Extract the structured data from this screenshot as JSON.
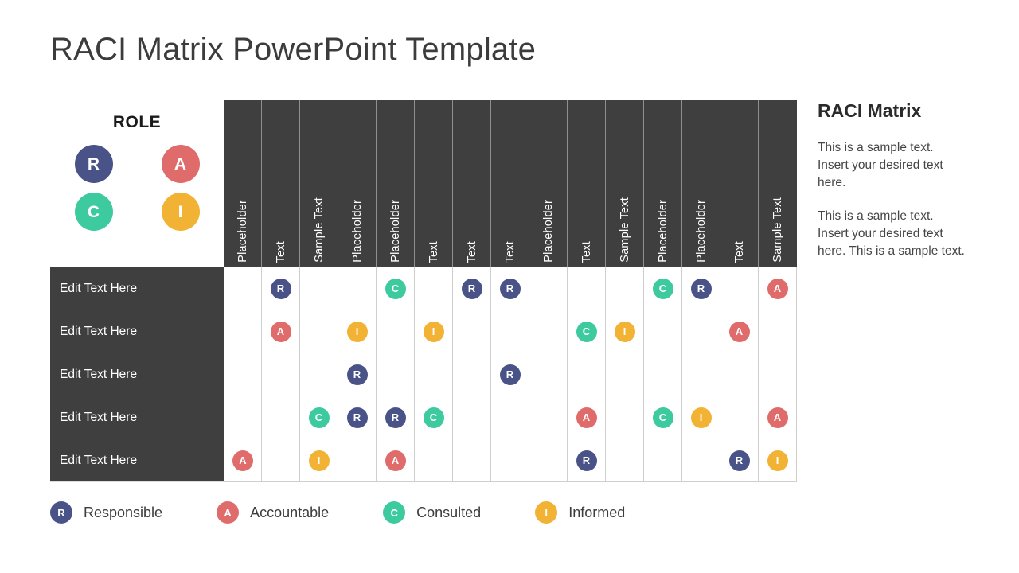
{
  "slide": {
    "title": "RACI Matrix PowerPoint Template"
  },
  "role_legend": {
    "heading": "ROLE",
    "items": [
      {
        "key": "R",
        "color": "#4A5387"
      },
      {
        "key": "A",
        "color": "#E06B6B"
      },
      {
        "key": "C",
        "color": "#3DCA9E"
      },
      {
        "key": "I",
        "color": "#F2B233"
      }
    ]
  },
  "matrix": {
    "column_headers": [
      "Placeholder",
      "Text",
      "Sample Text",
      "Placeholder",
      "Placeholder",
      "Text",
      "Text",
      "Text",
      "Placeholder",
      "Text",
      "Sample Text",
      "Placeholder",
      "Placeholder",
      "Text",
      "Sample Text"
    ],
    "rows": [
      {
        "label": "Edit Text Here",
        "cells": [
          "",
          "R",
          "",
          "",
          "C",
          "",
          "R",
          "R",
          "",
          "",
          "",
          "C",
          "R",
          "",
          "A"
        ]
      },
      {
        "label": "Edit Text Here",
        "cells": [
          "",
          "A",
          "",
          "I",
          "",
          "I",
          "",
          "",
          "",
          "C",
          "I",
          "",
          "",
          "A",
          ""
        ]
      },
      {
        "label": "Edit Text Here",
        "cells": [
          "",
          "",
          "",
          "R",
          "",
          "",
          "",
          "R",
          "",
          "",
          "",
          "",
          "",
          "",
          ""
        ]
      },
      {
        "label": "Edit Text Here",
        "cells": [
          "",
          "",
          "C",
          "R",
          "R",
          "C",
          "",
          "",
          "",
          "A",
          "",
          "C",
          "I",
          "",
          "A"
        ]
      },
      {
        "label": "Edit Text Here",
        "cells": [
          "A",
          "",
          "I",
          "",
          "A",
          "",
          "",
          "",
          "",
          "R",
          "",
          "",
          "",
          "R",
          "I"
        ]
      }
    ]
  },
  "legend": {
    "items": [
      {
        "key": "R",
        "label": "Responsible",
        "color": "#4A5387"
      },
      {
        "key": "A",
        "label": "Accountable",
        "color": "#E06B6B"
      },
      {
        "key": "C",
        "label": "Consulted",
        "color": "#3DCA9E"
      },
      {
        "key": "I",
        "label": "Informed",
        "color": "#F2B233"
      }
    ]
  },
  "side_panel": {
    "title": "RACI Matrix",
    "paragraphs": [
      "This is a sample text. Insert your desired text here.",
      "This is a sample text. Insert your desired text here. This is a sample text."
    ]
  },
  "palette": {
    "R": "#4A5387",
    "A": "#E06B6B",
    "C": "#3DCA9E",
    "I": "#F2B233",
    "header_bg": "#3f3f3f",
    "grid_line": "#cfcfcf"
  }
}
